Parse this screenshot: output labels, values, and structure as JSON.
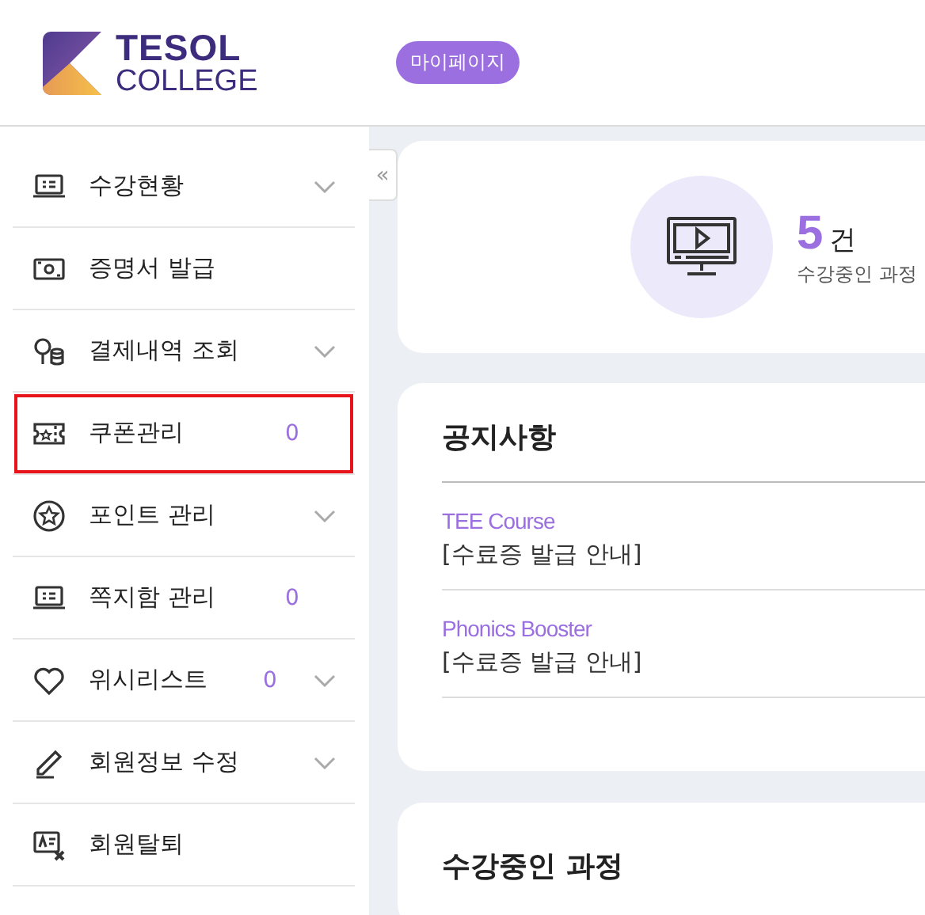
{
  "header": {
    "logo": {
      "line1": "TESOL",
      "line2": "COLLEGE"
    },
    "mypage_button": "마이페이지"
  },
  "sidebar": {
    "items": [
      {
        "label": "수강현황",
        "expandable": true,
        "highlighted": false
      },
      {
        "label": "증명서 발급",
        "expandable": false,
        "highlighted": false
      },
      {
        "label": "결제내역 조회",
        "expandable": true,
        "highlighted": false
      },
      {
        "label": "쿠폰관리",
        "count": "0",
        "expandable": false,
        "highlighted": true
      },
      {
        "label": "포인트 관리",
        "expandable": true,
        "highlighted": false
      },
      {
        "label": "쪽지함 관리",
        "count": "0",
        "expandable": false,
        "highlighted": false
      },
      {
        "label": "위시리스트",
        "count": "0",
        "expandable": true,
        "highlighted": false
      },
      {
        "label": "회원정보 수정",
        "expandable": true,
        "highlighted": false
      },
      {
        "label": "회원탈퇴",
        "expandable": false,
        "highlighted": false
      }
    ]
  },
  "collapse_button": "«",
  "summary": {
    "count": "5",
    "unit": "건",
    "caption": "수강중인 과정"
  },
  "notices": {
    "title": "공지사항",
    "items": [
      {
        "course": "TEE Course",
        "title": "[수료증 발급 안내]"
      },
      {
        "course": "Phonics Booster",
        "title": "[수료증 발급 안내]"
      }
    ]
  },
  "courses": {
    "title": "수강중인 과정"
  }
}
